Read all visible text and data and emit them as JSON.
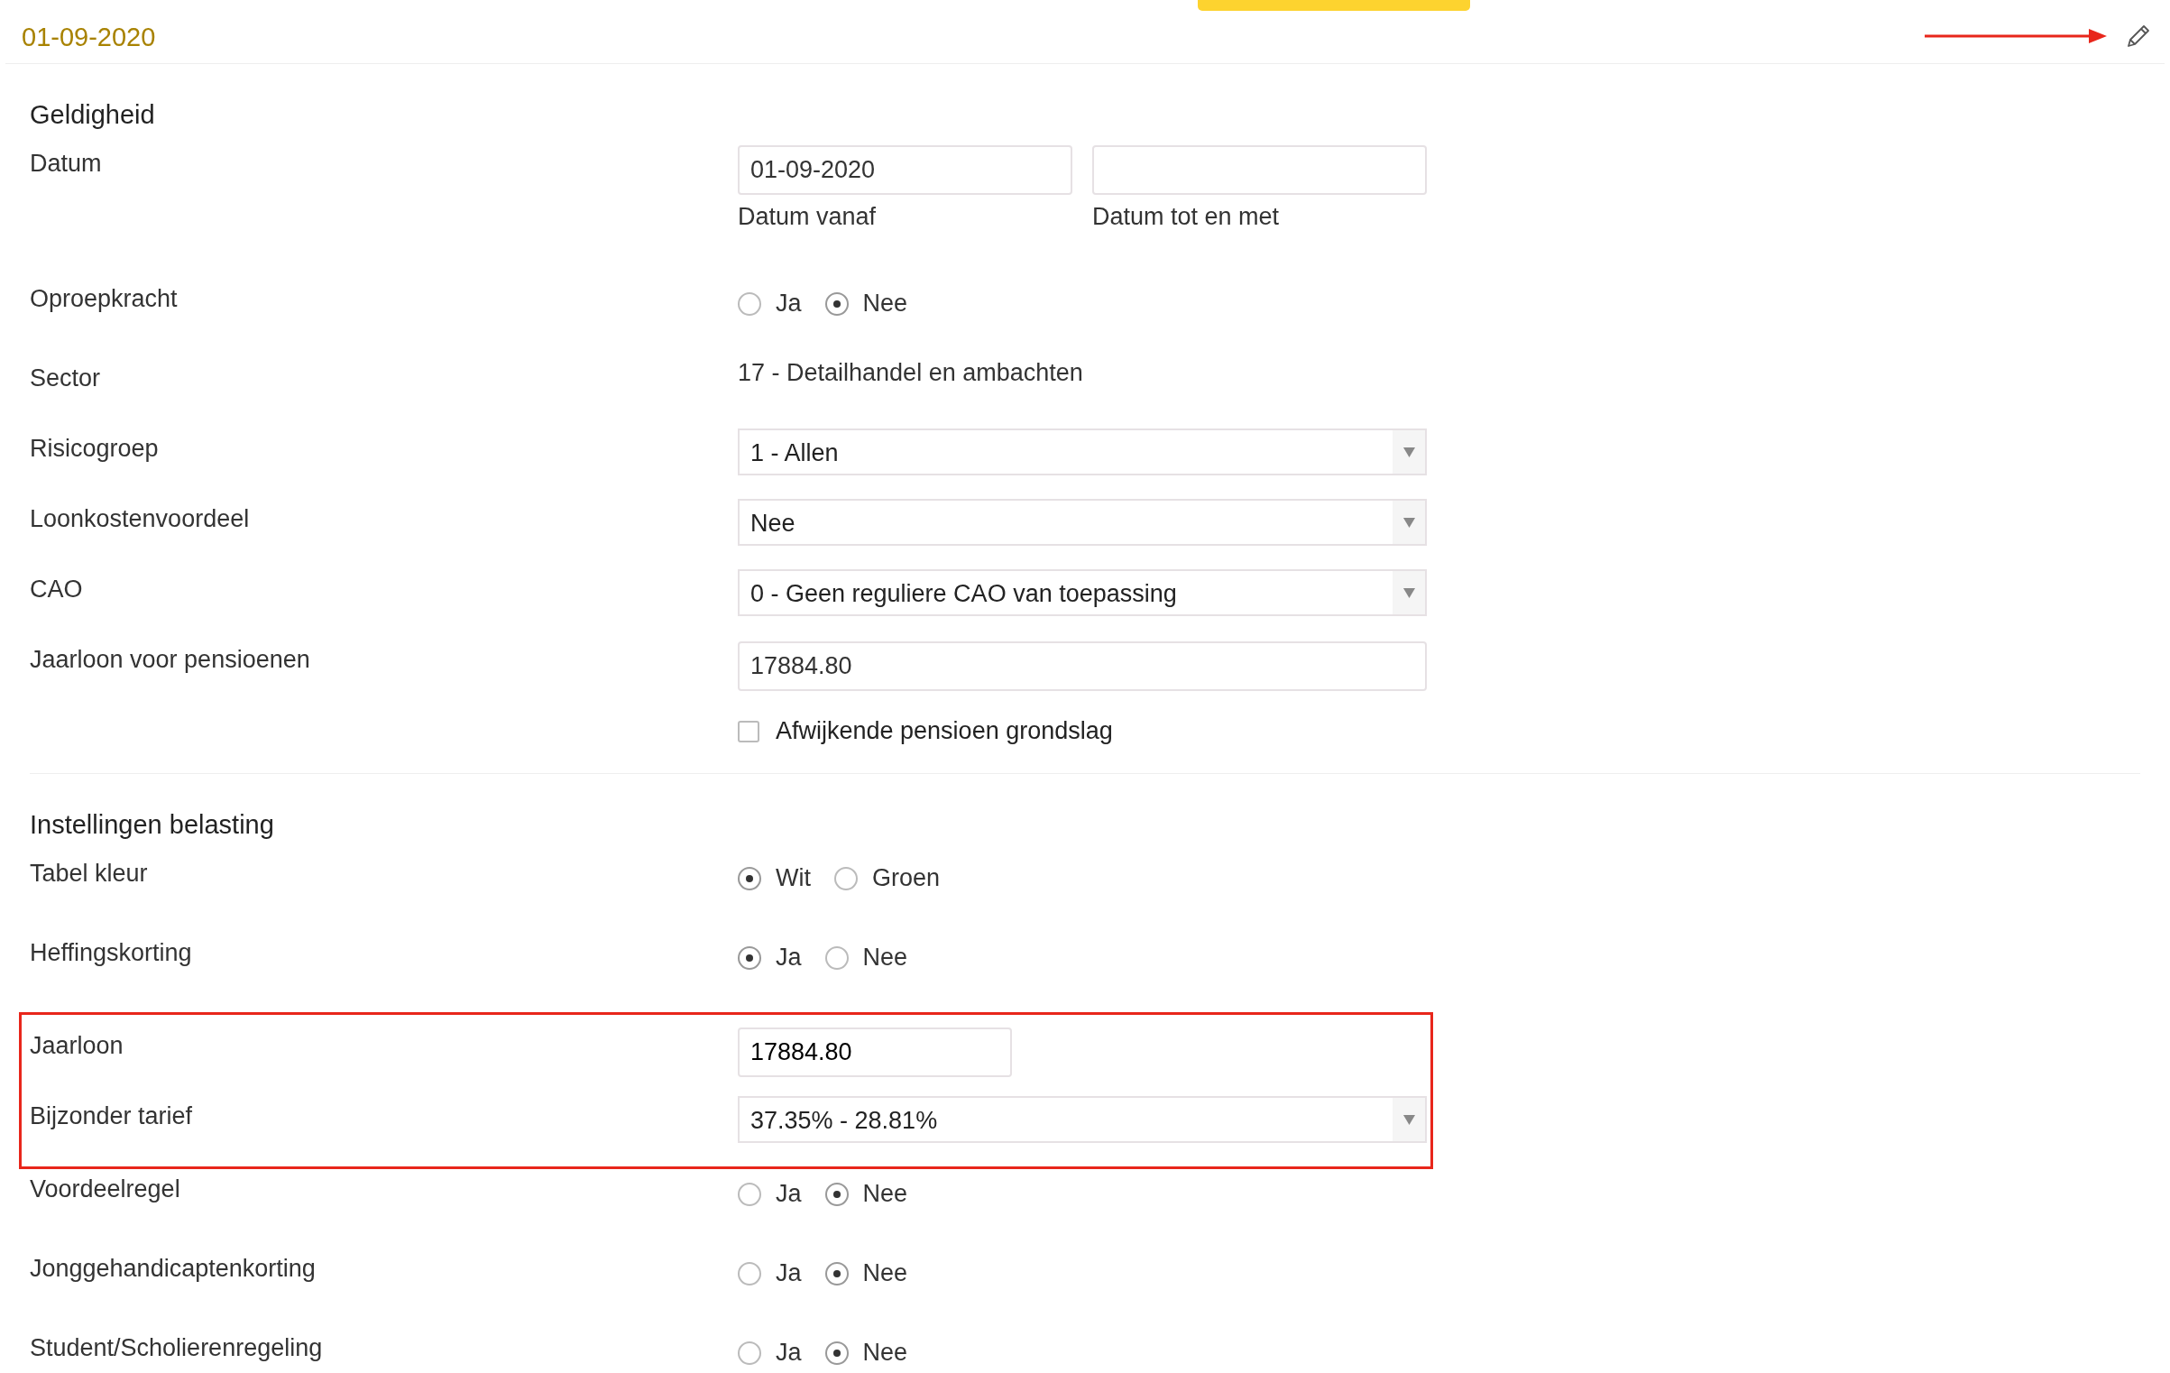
{
  "header": {
    "date": "01-09-2020"
  },
  "sections": [
    {
      "title": "Geldigheid",
      "rows": [
        {
          "kind": "date_range",
          "label": "Datum",
          "fields": [
            {
              "value": "01-09-2020",
              "caption": "Datum vanaf"
            },
            {
              "caption": "Datum tot en met"
            }
          ]
        },
        {
          "kind": "radio",
          "label": "Oproepkracht",
          "options": [
            {
              "label": "Ja",
              "selected": false
            },
            {
              "label": "Nee",
              "selected": true
            }
          ]
        },
        {
          "kind": "text",
          "label": "Sector",
          "value": "17 - Detailhandel en ambachten"
        },
        {
          "kind": "select",
          "label": "Risicogroep",
          "value": "1 - Allen"
        },
        {
          "kind": "select",
          "label": "Loonkostenvoordeel",
          "value": "Nee"
        },
        {
          "kind": "select",
          "label": "CAO",
          "value": "0 - Geen reguliere CAO van toepassing"
        },
        {
          "kind": "input",
          "label": "Jaarloon voor pensioenen",
          "value": "17884.80"
        },
        {
          "kind": "checkbox",
          "text": "Afwijkende pensioen grondslag",
          "checked": false
        }
      ]
    },
    {
      "title": "Instellingen belasting",
      "rows": [
        {
          "kind": "radio",
          "label": "Tabel kleur",
          "options": [
            {
              "label": "Wit",
              "selected": true
            },
            {
              "label": "Groen",
              "selected": false
            }
          ]
        },
        {
          "kind": "radio",
          "label": "Heffingskorting",
          "options": [
            {
              "label": "Ja",
              "selected": true
            },
            {
              "label": "Nee",
              "selected": false
            }
          ]
        },
        {
          "kind": "highlight",
          "rows": [
            {
              "kind": "input_short",
              "label": "Jaarloon",
              "value": "17884.80"
            },
            {
              "kind": "select",
              "label": "Bijzonder tarief",
              "value": "37.35% - 28.81%"
            }
          ]
        },
        {
          "kind": "radio",
          "label": "Voordeelregel",
          "options": [
            {
              "label": "Ja",
              "selected": false
            },
            {
              "label": "Nee",
              "selected": true
            }
          ]
        },
        {
          "kind": "radio",
          "label": "Jonggehandicaptenkorting",
          "options": [
            {
              "label": "Ja",
              "selected": false
            },
            {
              "label": "Nee",
              "selected": true
            }
          ]
        },
        {
          "kind": "radio",
          "label": "Student/Scholierenregeling",
          "options": [
            {
              "label": "Ja",
              "selected": false
            },
            {
              "label": "Nee",
              "selected": true
            }
          ]
        }
      ]
    }
  ]
}
